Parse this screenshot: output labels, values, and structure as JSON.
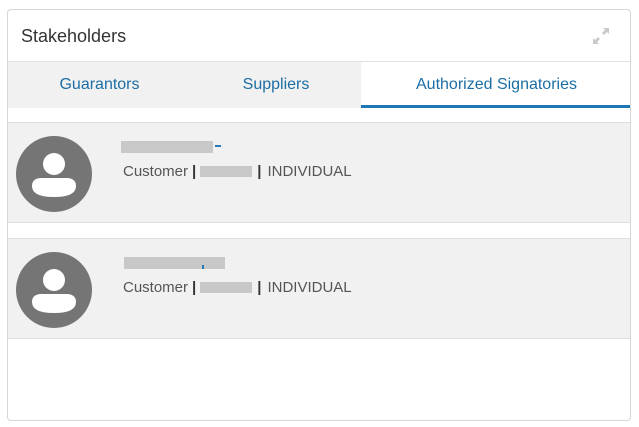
{
  "widget": {
    "title": "Stakeholders"
  },
  "tabs": [
    {
      "label": "Guarantors",
      "active": false
    },
    {
      "label": "Suppliers",
      "active": false
    },
    {
      "label": "Authorized Signatories",
      "active": true
    }
  ],
  "stakeholders": [
    {
      "type": "Customer",
      "separator": "|",
      "category": "INDIVIDUAL"
    },
    {
      "type": "Customer",
      "separator": "|",
      "category": "INDIVIDUAL"
    }
  ],
  "colors": {
    "accent": "#1c78b4",
    "tab_text": "#1c6ea4",
    "card_bg": "#f1f1f1",
    "avatar": "#757575"
  }
}
